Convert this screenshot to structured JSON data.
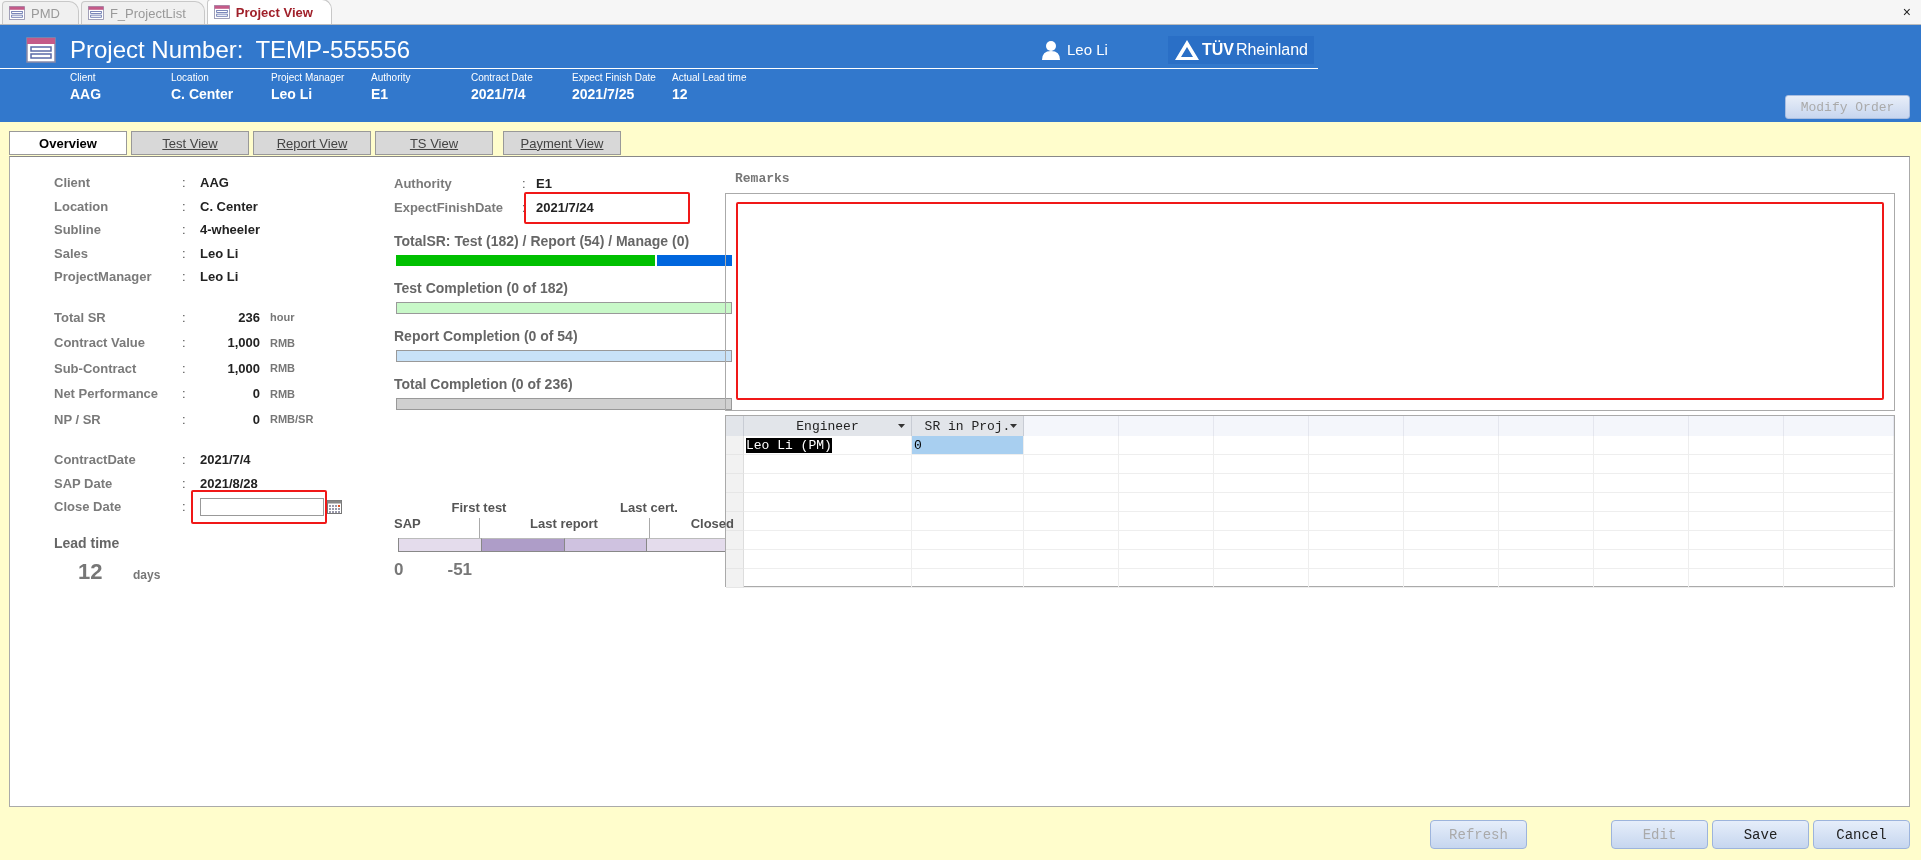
{
  "doc_tabs": [
    {
      "label": "PMD",
      "selected": false
    },
    {
      "label": "F_ProjectList",
      "selected": false
    },
    {
      "label": "Project View",
      "selected": true
    }
  ],
  "close_symbol": "×",
  "header": {
    "title": "Project Number:",
    "project_number": "TEMP-555556",
    "user": "Leo Li",
    "logo_brand": "TÜV",
    "logo_rest": "Rheinland",
    "info": [
      {
        "label": "Client",
        "value": "AAG"
      },
      {
        "label": "Location",
        "value": "C. Center"
      },
      {
        "label": "Project Manager",
        "value": "Leo Li"
      },
      {
        "label": "Authority",
        "value": "E1"
      },
      {
        "label": "Contract Date",
        "value": "2021/7/4"
      },
      {
        "label": "Expect Finish Date",
        "value": "2021/7/25"
      },
      {
        "label": "Actual Lead time",
        "value": "12"
      }
    ],
    "modify_button": {
      "label": "Modify Order",
      "disabled": true
    }
  },
  "view_tabs": [
    {
      "label": "Overview",
      "selected": true
    },
    {
      "label": "Test View",
      "selected": false
    },
    {
      "label": "Report View",
      "selected": false
    },
    {
      "label": "TS View",
      "selected": false
    },
    {
      "label": "Payment View",
      "selected": false
    }
  ],
  "general": [
    {
      "label": "Client",
      "value": "AAG"
    },
    {
      "label": "Location",
      "value": "C. Center"
    },
    {
      "label": "Subline",
      "value": "4-wheeler"
    },
    {
      "label": "Sales",
      "value": "Leo Li"
    },
    {
      "label": "ProjectManager",
      "value": "Leo Li"
    }
  ],
  "figures": [
    {
      "label": "Total SR",
      "value": "236",
      "unit": "hour"
    },
    {
      "label": "Contract Value",
      "value": "1,000",
      "unit": "RMB"
    },
    {
      "label": "Sub-Contract",
      "value": "1,000",
      "unit": "RMB"
    },
    {
      "label": "Net Performance",
      "value": "0",
      "unit": "RMB"
    },
    {
      "label": "NP / SR",
      "value": "0",
      "unit": "RMB/SR"
    }
  ],
  "dates": [
    {
      "label": "ContractDate",
      "value": "2021/7/4"
    },
    {
      "label": "SAP Date",
      "value": "2021/8/28"
    }
  ],
  "close_date": {
    "label": "Close Date"
  },
  "separator": ":",
  "lead_time": {
    "label": "Lead time",
    "value": "12",
    "unit": "days"
  },
  "authority": {
    "label": "Authority",
    "value": "E1"
  },
  "expect_finish": {
    "label": "ExpectFinishDate",
    "value": "2021/7/24"
  },
  "total_sr": {
    "title": "TotalSR: Test (182) / Report (54) / Manage (0)",
    "segments": [
      {
        "level": 0.771,
        "color": "#00c000"
      },
      {
        "level": 0.229,
        "color": "#0066dd"
      }
    ]
  },
  "completions": [
    {
      "title": "Test Completion (0 of 182)",
      "level": 0,
      "color": "#c8f8c8"
    },
    {
      "title": "Report Completion (0 of 54)",
      "level": 0,
      "color": "#c8e2f8"
    },
    {
      "title": "Total Completion (0 of 236)",
      "level": 0,
      "color": "#d0d0d0"
    }
  ],
  "timeline": {
    "milestones": [
      "SAP",
      "First test",
      "Last report",
      "Last cert.",
      "Closed"
    ],
    "segments": [
      {
        "color": "#e4dcec"
      },
      {
        "color": "#ae9dc8"
      },
      {
        "color": "#cfc2e0"
      },
      {
        "color": "#e4dcec"
      }
    ],
    "days": [
      "0",
      "-51"
    ]
  },
  "remarks": {
    "label": "Remarks"
  },
  "grid": {
    "columns": [
      "Engineer",
      "SR in Proj."
    ],
    "rows": [
      {
        "cells": [
          "Leo Li (PM)",
          "0"
        ],
        "selected": true
      }
    ]
  },
  "buttons": [
    {
      "label": "Refresh",
      "disabled": true
    },
    {
      "label": "Edit",
      "disabled": true
    },
    {
      "label": "Save",
      "disabled": false
    },
    {
      "label": "Cancel",
      "disabled": false
    }
  ]
}
